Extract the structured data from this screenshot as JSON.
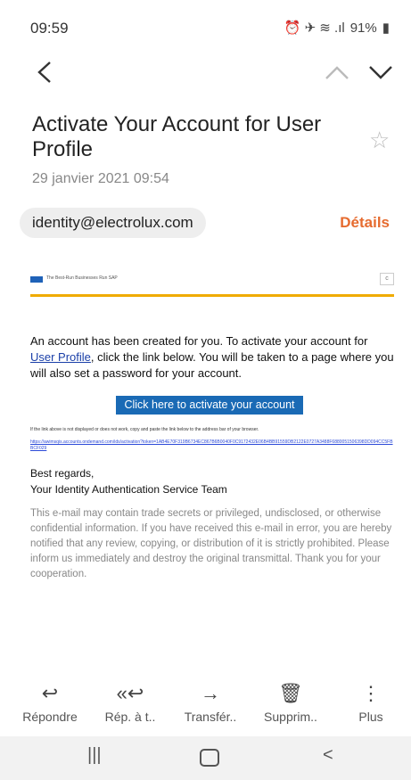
{
  "status": {
    "time": "09:59",
    "icons_text": "⏰ ✈ ≋ .ıl",
    "battery": "91%"
  },
  "nav": {
    "back_icon": "chevron-left-icon",
    "prev_icon": "chevron-up-icon",
    "next_icon": "chevron-down-icon"
  },
  "email": {
    "subject": "Activate Your Account for User Profile",
    "date": "29 janvier 2021  09:54",
    "sender": "identity@electrolux.com",
    "details_label": "Détails",
    "banner_tagline": "The Best-Run Businesses Run SAP",
    "banner_img_alt": "c",
    "intro_before_link": "An account has been created for you. To activate your account for ",
    "intro_link": "User Profile",
    "intro_after_link": ", click the link below. You will be taken to a page where you will also set a password for your account.",
    "cta_label": "Click here to activate your account",
    "fallback_text": "If the link above is not displayed or does not work, copy and paste the link below to the address bar of your browser.",
    "fallback_link": "https://awimsqis.accounts.ondemand.com/ids/activation?token=1AB4E70F319B6734EC867B6B0040F0C9172432E06B4BB91559DB2122E0727A3488F6880051506398DD094CC5FBBCF029",
    "regards_line1": "Best regards,",
    "regards_line2": "Your Identity Authentication Service Team",
    "disclaimer": "This e-mail may contain trade secrets or privileged, undisclosed, or otherwise confidential information. If you have received this e-mail in error, you are hereby notified that any review, copying, or distribution of it is strictly prohibited. Please inform us immediately and destroy the original transmittal. Thank you for your cooperation."
  },
  "actions": [
    {
      "label": "Répondre",
      "icon": "reply-icon"
    },
    {
      "label": "Rép. à t..",
      "icon": "reply-all-icon"
    },
    {
      "label": "Transfér..",
      "icon": "forward-icon"
    },
    {
      "label": "Supprim..",
      "icon": "trash-icon"
    },
    {
      "label": "Plus",
      "icon": "more-vertical-icon"
    }
  ],
  "system_nav": {
    "recents_icon": "recents-icon",
    "home_icon": "home-icon",
    "back_icon": "back-icon"
  }
}
